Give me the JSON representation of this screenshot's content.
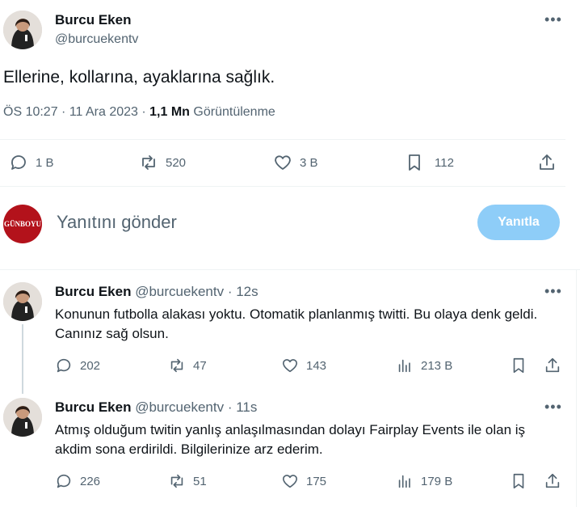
{
  "main_tweet": {
    "author": "Burcu Eken",
    "handle": "@burcuekentv",
    "text": "Ellerine, kollarına, ayaklarına sağlık.",
    "time": "ÖS 10:27 · 11 Ara 2023 · ",
    "views_count": "1,1 Mn",
    "views_label": " Görüntülenme",
    "actions": {
      "replies": "1 B",
      "retweets": "520",
      "likes": "3 B",
      "bookmarks": "112"
    }
  },
  "reply_box": {
    "avatar_text": "GÜNBOYU",
    "placeholder": "Yanıtını gönder",
    "button": "Yanıtla"
  },
  "replies": [
    {
      "author": "Burcu Eken",
      "handle": "@burcuekentv",
      "time": "· 12s",
      "text": "Konunun futbolla alakası yoktu. Otomatik planlanmış twitti. Bu olaya denk geldi. Canınız sağ olsun.",
      "replies": "202",
      "retweets": "47",
      "likes": "143",
      "views": "213 B"
    },
    {
      "author": "Burcu Eken",
      "handle": "@burcuekentv",
      "time": "· 11s",
      "text": "Atmış olduğum twitin yanlış anlaşılmasından dolayı Fairplay Events ile olan iş akdim sona erdirildi. Bilgilerinize arz ederim.",
      "replies": "226",
      "retweets": "51",
      "likes": "175",
      "views": "179 B"
    }
  ],
  "colors": {
    "accent_disabled": "#8ecdf8",
    "muted": "#536471",
    "brand_red": "#b3121b"
  }
}
